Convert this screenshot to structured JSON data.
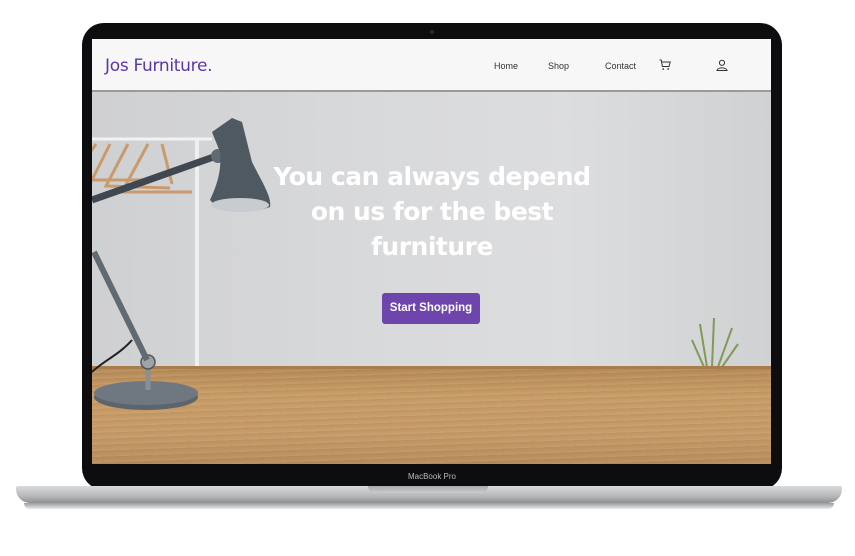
{
  "navbar": {
    "brand": "Jos Furniture.",
    "links": {
      "home": "Home",
      "shop": "Shop",
      "contact": "Contact"
    },
    "icons": {
      "cart": "cart-icon",
      "user": "user-icon"
    }
  },
  "hero": {
    "title": "You can always depend on us for the best furniture",
    "cta_label": "Start Shopping"
  },
  "device": {
    "model_label": "MacBook Pro"
  },
  "colors": {
    "brand": "#5b36a6",
    "cta": "#6d45ad"
  }
}
